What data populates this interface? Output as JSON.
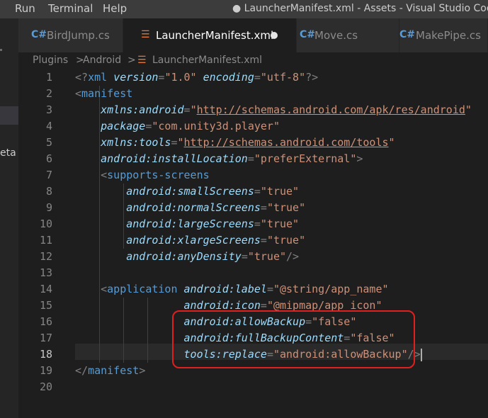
{
  "menu": [
    "Run",
    "Terminal",
    "Help"
  ],
  "window_title": "● LauncherManifest.xml - Assets - Visual Studio Code",
  "left_strip_text": "eta",
  "tabs": [
    {
      "label": "BirdJump.cs",
      "icon": "C#",
      "icon_name": "csharp-icon",
      "active": false
    },
    {
      "label": "LauncherManifest.xml",
      "icon": "☰",
      "icon_name": "rss-xml-icon",
      "active": true,
      "dirty": true
    },
    {
      "label": "Move.cs",
      "icon": "C#",
      "icon_name": "csharp-icon",
      "active": false
    },
    {
      "label": "MakePipe.cs",
      "icon": "C#",
      "icon_name": "csharp-icon",
      "active": false
    }
  ],
  "breadcrumb": {
    "items": [
      "Plugins",
      "Android",
      "LauncherManifest.xml"
    ],
    "separator": ">"
  },
  "editor": {
    "current_line": 18,
    "lines": [
      {
        "n": "1",
        "t": [
          [
            "pun",
            "<?"
          ],
          [
            "tg",
            "xml"
          ],
          [
            "pun",
            " "
          ],
          [
            "at",
            "version"
          ],
          [
            "pun",
            "="
          ],
          [
            "str",
            "\"1.0\""
          ],
          [
            "pun",
            " "
          ],
          [
            "at",
            "encoding"
          ],
          [
            "pun",
            "="
          ],
          [
            "str",
            "\"utf-8\""
          ],
          [
            "pun",
            "?>"
          ]
        ]
      },
      {
        "n": "2",
        "t": [
          [
            "pun",
            "<"
          ],
          [
            "tg",
            "manifest"
          ]
        ]
      },
      {
        "n": "3",
        "t": [
          [
            "pun",
            "    "
          ],
          [
            "ns",
            "xmlns:android"
          ],
          [
            "pun",
            "="
          ],
          [
            "str",
            "\""
          ],
          [
            "link",
            "http://schemas.android.com/apk/res/android"
          ],
          [
            "str",
            "\""
          ]
        ]
      },
      {
        "n": "4",
        "t": [
          [
            "pun",
            "    "
          ],
          [
            "at",
            "package"
          ],
          [
            "pun",
            "="
          ],
          [
            "str",
            "\"com.unity3d.player\""
          ]
        ]
      },
      {
        "n": "5",
        "t": [
          [
            "pun",
            "    "
          ],
          [
            "ns",
            "xmlns:tools"
          ],
          [
            "pun",
            "="
          ],
          [
            "str",
            "\""
          ],
          [
            "link",
            "http://schemas.android.com/tools"
          ],
          [
            "str",
            "\""
          ]
        ]
      },
      {
        "n": "6",
        "t": [
          [
            "pun",
            "    "
          ],
          [
            "at",
            "android:installLocation"
          ],
          [
            "pun",
            "="
          ],
          [
            "str",
            "\"preferExternal\""
          ],
          [
            "pun",
            ">"
          ]
        ]
      },
      {
        "n": "7",
        "t": [
          [
            "pun",
            "    <"
          ],
          [
            "tg",
            "supports-screens"
          ]
        ]
      },
      {
        "n": "8",
        "t": [
          [
            "pun",
            "        "
          ],
          [
            "at",
            "android:smallScreens"
          ],
          [
            "pun",
            "="
          ],
          [
            "str",
            "\"true\""
          ]
        ]
      },
      {
        "n": "9",
        "t": [
          [
            "pun",
            "        "
          ],
          [
            "at",
            "android:normalScreens"
          ],
          [
            "pun",
            "="
          ],
          [
            "str",
            "\"true\""
          ]
        ]
      },
      {
        "n": "10",
        "t": [
          [
            "pun",
            "        "
          ],
          [
            "at",
            "android:largeScreens"
          ],
          [
            "pun",
            "="
          ],
          [
            "str",
            "\"true\""
          ]
        ]
      },
      {
        "n": "11",
        "t": [
          [
            "pun",
            "        "
          ],
          [
            "at",
            "android:xlargeScreens"
          ],
          [
            "pun",
            "="
          ],
          [
            "str",
            "\"true\""
          ]
        ]
      },
      {
        "n": "12",
        "t": [
          [
            "pun",
            "        "
          ],
          [
            "at",
            "android:anyDensity"
          ],
          [
            "pun",
            "="
          ],
          [
            "str",
            "\"true\""
          ],
          [
            "pun",
            "/>"
          ]
        ]
      },
      {
        "n": "13",
        "t": []
      },
      {
        "n": "14",
        "t": [
          [
            "pun",
            "    <"
          ],
          [
            "tg",
            "application"
          ],
          [
            "pun",
            " "
          ],
          [
            "at",
            "android:label"
          ],
          [
            "pun",
            "="
          ],
          [
            "str",
            "\"@string/app_name\""
          ]
        ]
      },
      {
        "n": "15",
        "t": [
          [
            "pun",
            "                 "
          ],
          [
            "at",
            "android:icon"
          ],
          [
            "pun",
            "="
          ],
          [
            "str",
            "\"@mipmap/app_icon\""
          ]
        ]
      },
      {
        "n": "16",
        "t": [
          [
            "pun",
            "                 "
          ],
          [
            "at",
            "android:allowBackup"
          ],
          [
            "pun",
            "="
          ],
          [
            "str",
            "\"false\""
          ]
        ]
      },
      {
        "n": "17",
        "t": [
          [
            "pun",
            "                 "
          ],
          [
            "at",
            "android:fullBackupContent"
          ],
          [
            "pun",
            "="
          ],
          [
            "str",
            "\"false\""
          ]
        ]
      },
      {
        "n": "18",
        "t": [
          [
            "pun",
            "                 "
          ],
          [
            "at",
            "tools:replace"
          ],
          [
            "pun",
            "="
          ],
          [
            "str",
            "\"android:allowBackup\""
          ],
          [
            "pun",
            "/>"
          ]
        ]
      },
      {
        "n": "19",
        "t": [
          [
            "pun",
            "</"
          ],
          [
            "tg",
            "manifest"
          ],
          [
            "pun",
            ">"
          ]
        ]
      },
      {
        "n": "20",
        "t": []
      }
    ]
  },
  "colors": {
    "background": "#1e1e1e",
    "tag": "#569cd6",
    "attribute": "#9cdcfe",
    "string": "#ce9178",
    "punctuation": "#808080",
    "highlight_box": "#e0201f"
  }
}
